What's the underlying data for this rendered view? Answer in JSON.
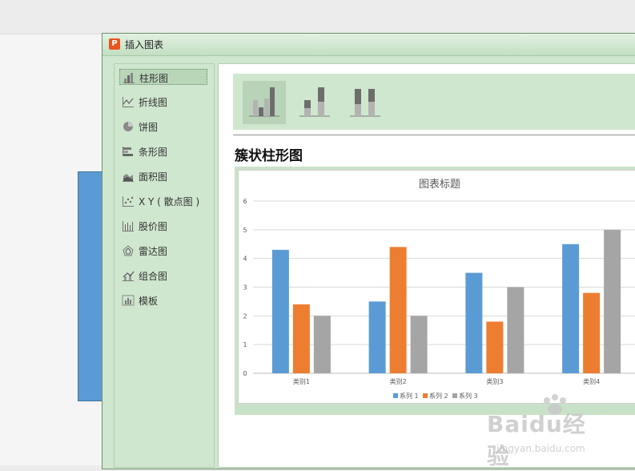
{
  "dialog": {
    "title": "插入图表",
    "app_icon_letter": "P"
  },
  "chart_types": [
    {
      "label": "柱形图",
      "icon": "column-chart-icon",
      "selected": true
    },
    {
      "label": "折线图",
      "icon": "line-chart-icon"
    },
    {
      "label": "饼图",
      "icon": "pie-chart-icon"
    },
    {
      "label": "条形图",
      "icon": "bar-chart-icon"
    },
    {
      "label": "面积图",
      "icon": "area-chart-icon"
    },
    {
      "label": "X Y ( 散点图 )",
      "icon": "scatter-chart-icon"
    },
    {
      "label": "股价图",
      "icon": "stock-chart-icon"
    },
    {
      "label": "雷达图",
      "icon": "radar-chart-icon"
    },
    {
      "label": "组合图",
      "icon": "combo-chart-icon"
    },
    {
      "label": "模板",
      "icon": "template-icon"
    }
  ],
  "subtypes": [
    {
      "name": "clustered-column",
      "selected": true
    },
    {
      "name": "stacked-column"
    },
    {
      "name": "percent-stacked-column"
    }
  ],
  "selected_subtype_title": "簇状柱形图",
  "colors": {
    "series1": "#5b9bd5",
    "series2": "#ed7d31",
    "series3": "#a5a5a5",
    "dialog_green": "#cfe6cf"
  },
  "chart_data": {
    "type": "bar",
    "title": "图表标题",
    "categories": [
      "类别1",
      "类别2",
      "类别3",
      "类别4"
    ],
    "series": [
      {
        "name": "系列 1",
        "values": [
          4.3,
          2.5,
          3.5,
          4.5
        ]
      },
      {
        "name": "系列 2",
        "values": [
          2.4,
          4.4,
          1.8,
          2.8
        ]
      },
      {
        "name": "系列 3",
        "values": [
          2,
          2,
          3,
          5
        ]
      }
    ],
    "ylim": [
      0,
      6
    ],
    "yticks": [
      0,
      1,
      2,
      3,
      4,
      5,
      6
    ],
    "grid": true,
    "legend": "bottom"
  },
  "watermark": {
    "brand": "Baidu经验",
    "url": "jingyan.baidu.com"
  }
}
